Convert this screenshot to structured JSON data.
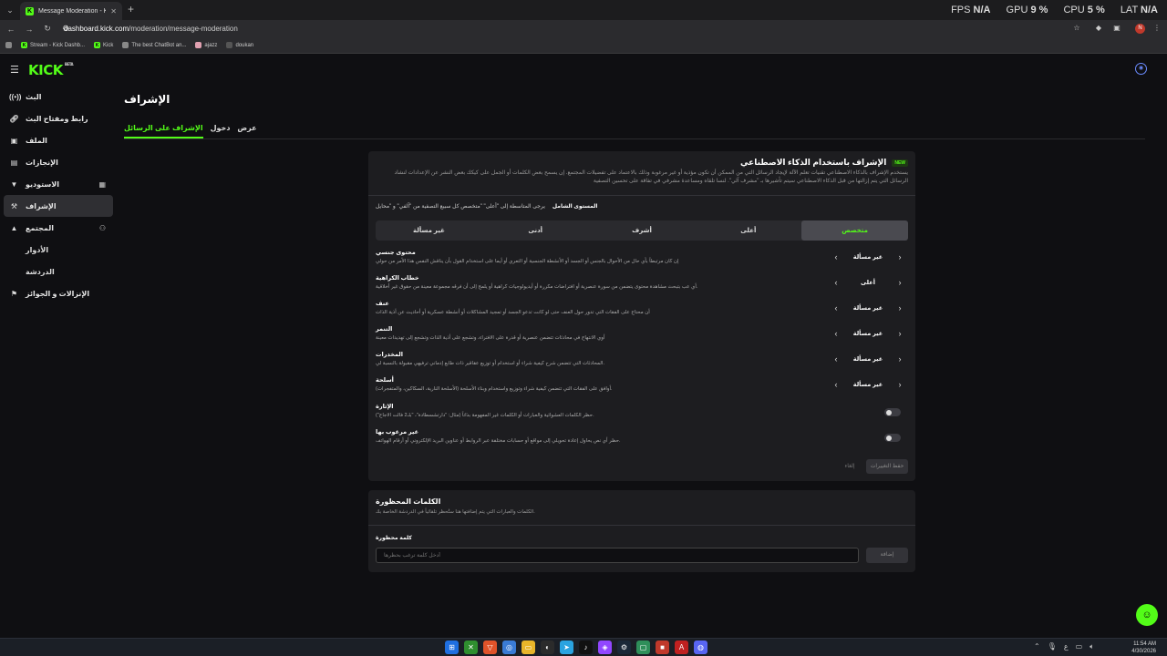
{
  "browser": {
    "tab_title": "Message Moderation - Kick Da",
    "url_host": "dashboard.kick.com",
    "url_path": "/moderation/message-moderation",
    "new_tab": "+",
    "perf": {
      "fps_label": "FPS",
      "fps": "N/A",
      "gpu_label": "GPU",
      "gpu": "9 %",
      "cpu_label": "CPU",
      "cpu": "5 %",
      "lat_label": "LAT",
      "lat": "N/A"
    },
    "profile_initial": "N",
    "bookmarks": [
      "Stream - Kick Dashb...",
      "Kick",
      "The best ChatBot an...",
      "ajazz",
      "doukan"
    ]
  },
  "app": {
    "logo": "KICK",
    "logo_sup": "BETA",
    "sidebar": {
      "items": [
        {
          "label": "البث",
          "icon": "broadcast-icon"
        },
        {
          "label": "رابط ومفتاح البث",
          "icon": "link-icon"
        },
        {
          "label": "الملف",
          "icon": "profile-icon"
        },
        {
          "label": "الإنجازات",
          "icon": "achievements-icon"
        },
        {
          "label": "الاستوديو",
          "icon": "studio-icon"
        },
        {
          "label": "الإشراف",
          "icon": "moderation-icon"
        },
        {
          "label": "المجتمع",
          "icon": "community-icon"
        }
      ],
      "sub": [
        "الأدوار",
        "الدردشة"
      ],
      "last": {
        "label": "الإنزالات و الجوائز",
        "icon": "drops-icon"
      }
    },
    "page_title": "الإشراف",
    "tabs": [
      "الإشراف على الرسائل",
      "دخول",
      "عرض"
    ]
  },
  "ai_card": {
    "badge": "NEW",
    "title": "الإشراف باستخدام الذكاء الاصطناعي",
    "description": "يستخدم الإشراف بالذكاء الاصطناعي تقنيات تعلم الآلة لإيجاد الرسائل التي من الممكن أن تكون مؤذية أو غير مرغوبة وذلك بالاعتماد على تفضيلات المجتمع. إن يسمح بعض الكلمات أو الجمل على كيكك بعض النشر عن الإعدادات لنشاد الرسائل التي يتم إزالتها من قبل الذكاء الاصطناعي سيتم تأشيرها بـ \"مشرف آلي\". لنسا تلقاه ومساعدة مشرفي في تفاقة على تحسين التصفية",
    "level_label": "المستوى الشامل",
    "level_hint": "يرجى المتاسطة إلى \"أعلى\" \"متخصص كل سبيع التصفية من \"آلفي\" و \"محايل",
    "levels": [
      "متخصص",
      "أعلى",
      "أشرف",
      "أدنى",
      "غير مسألة"
    ],
    "categories": [
      {
        "name": "محتوى جنسي",
        "desc": "إن كان مرتبطاً بأي حال من الأحوال بالجنس أو الجسد أو الأنشطة الجنسية أو التعري أو أيما على استخدام القول بأن يناقش النفس هذا الأمر من حولي",
        "value": "غير مسألة"
      },
      {
        "name": "خطاب الكراهية",
        "desc": "أي عب بتبحث مشاهدة محتوى يتضمن من سورة عنصرية أو افتراضات مكررة أو أيديولوجيات كراهية أو يلمح إلى أن فرقه مجموعة معينة من حقوق غير أخلاقية.",
        "value": "أعلى"
      },
      {
        "name": "عنف",
        "desc": "أن محتاج على الفقات التي تدور حول العنف حتى لو كانت تدعو الجسد أو تمجيد المشاكلات أو أنشطة عسكرية أو أحاديث عن أذية الذات",
        "value": "غير مسألة"
      },
      {
        "name": "التنمر",
        "desc": "أوي الانتهاج في محادثات تتضمن عنصرية أو قدرة على الافتراء، وتشجع على أذية الذات وتشجع إلى تهديدات معينة",
        "value": "غير مسألة"
      },
      {
        "name": "المخدرات",
        "desc": "المحادثات التي تتضمن شرح كيفية شراء أو استخدام أو توزيع عقاقير ذات طابع إدماني ترفيهي مقبولة بالنسبة لي.",
        "value": "غير مسألة"
      },
      {
        "name": "أسلحة",
        "desc": "أوافق على الفقات التي تتضمن كيفية شراء وتوزيع واستخدام وبناء الأسلحة (الأسلحة النارية، السكاكين، والمتفجرات).",
        "value": "غير مسألة"
      }
    ],
    "toggles": [
      {
        "name": "الإثارة",
        "desc": "حظر الكلمات العشوائية والعبارات أو الكلمات غير المفهومة بذاتاً (مثال: \"دارتشسطادة\"، \"بلـ2 فالت الاجاج\")."
      },
      {
        "name": "غير مرغوب بها",
        "desc": "حظر أي نص يحاول إعادة تحويلي إلى مواقع أو حسابات مختلفة عبر الروابط أو عناوين البريد الإلكتروني أو أرقام الهواتف."
      }
    ],
    "cancel": "إلغاء",
    "save": "حفظ التغييرات"
  },
  "banned_card": {
    "title": "الكلمات المحظورة",
    "description": "الكلمات والعبارات التي يتم إضافتها هنا ستُحظر تلقائياً في الدردشة الخاصة بك.",
    "label": "كلمة محظورة",
    "placeholder": "أدخل كلمة ترغب بحظرها",
    "add": "إضافة"
  },
  "taskbar": {
    "time": "11:54 AM",
    "date": "4/30/2026",
    "lang": "ع"
  }
}
